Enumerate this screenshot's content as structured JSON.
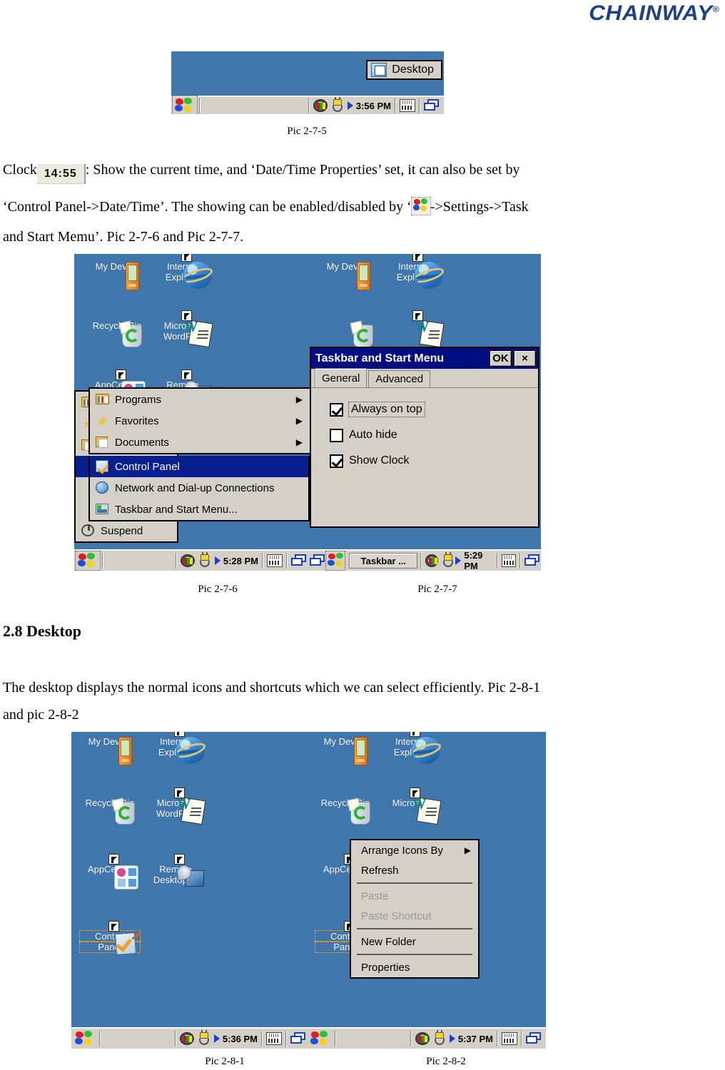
{
  "header": {
    "brand": "CHAINWAY",
    "registered": "®"
  },
  "pic275": {
    "caption": "Pic 2-7-5",
    "flyout_label": "Desktop",
    "flyout_icon": "desktop-icon",
    "tray_time": "3:56 PM"
  },
  "para1": {
    "before_clock": "Clock",
    "clock_value": "14:55",
    "after_clock": ": Show the current time, and ‘Date/Time Properties’ set, it can also be set by",
    "line2_a": "‘Control Panel->Date/Time’. The showing can be enabled/disabled by ‘",
    "line2_b": "->Settings->Task",
    "line3": "and Start Memu’. Pic 2-7-6 and Pic 2-7-7."
  },
  "desktop_icons": {
    "my_device": "My Device",
    "internet_explorer": "Internet\nExplorer",
    "internet_explorer_l1": "Internet",
    "internet_explorer_l2": "Explorer",
    "recycle_bin": "Recycle Bin",
    "wordpad_l1": "Microsoft",
    "wordpad_l2": "WordPad",
    "appcenter": "AppCenter",
    "remote_l1": "Remote",
    "remote_l2": "Desktop ...",
    "control_panel_l1": "Control",
    "control_panel_l2": "Panel"
  },
  "pic276": {
    "caption": "Pic 2-7-6",
    "tray_time": "5:28 PM",
    "start_menu_items": [
      {
        "label": "Programs",
        "icon": "programs-icon",
        "submenu": true,
        "state": "normal"
      },
      {
        "label": "Favorites",
        "icon": "favorites-icon",
        "submenu": true,
        "state": "normal"
      },
      {
        "label": "Documents",
        "icon": "documents-icon",
        "submenu": true,
        "state": "normal"
      }
    ],
    "settings_submenu": [
      {
        "label": "Control Panel",
        "icon": "control-panel-icon",
        "state": "highlighted"
      },
      {
        "label": "Network and Dial-up Connections",
        "icon": "network-icon",
        "state": "normal"
      },
      {
        "label": "Taskbar and Start Menu...",
        "icon": "taskbar-icon",
        "state": "normal"
      }
    ],
    "behind_items": [
      {
        "label": "Suspend",
        "icon": "suspend-icon"
      }
    ]
  },
  "pic277": {
    "caption": "Pic 2-7-7",
    "tray_time": "5:29 PM",
    "taskbar_button": "Taskbar ...",
    "dialog": {
      "title": "Taskbar and Start Menu",
      "ok": "OK",
      "close": "×",
      "tabs": [
        {
          "label": "General",
          "active": true
        },
        {
          "label": "Advanced",
          "active": false
        }
      ],
      "options": [
        {
          "label": "Always on top",
          "checked": true,
          "focused": true,
          "accel": "t"
        },
        {
          "label": "Auto hide",
          "checked": false,
          "focused": false,
          "accel": "u"
        },
        {
          "label": "Show Clock",
          "checked": true,
          "focused": false,
          "accel": "C"
        }
      ]
    }
  },
  "section28": {
    "heading": "2.8 Desktop",
    "body_line1": "The desktop displays the normal icons and shortcuts which we can select efficiently. Pic 2-8-1",
    "body_line2": "and pic 2-8-2"
  },
  "pic281": {
    "caption": "Pic 2-8-1",
    "tray_time": "5:36 PM"
  },
  "pic282": {
    "caption": "Pic 2-8-2",
    "tray_time": "5:37 PM",
    "context_menu": [
      {
        "label": "Arrange Icons By",
        "submenu": true,
        "state": "normal",
        "divider_after": false
      },
      {
        "label": "Refresh",
        "submenu": false,
        "state": "normal",
        "divider_after": true
      },
      {
        "label": "Paste",
        "submenu": false,
        "state": "disabled",
        "divider_after": false
      },
      {
        "label": "Paste Shortcut",
        "submenu": false,
        "state": "disabled",
        "divider_after": true
      },
      {
        "label": "New Folder",
        "submenu": false,
        "state": "normal",
        "divider_after": true
      },
      {
        "label": "Properties",
        "submenu": false,
        "state": "normal",
        "divider_after": false
      }
    ]
  },
  "colors": {
    "brand_blue": "#1f3f88",
    "desktop_blue": "#3f77ac",
    "taskbar_gray": "#d4d0c8",
    "title_navy": "#000e80",
    "menu_highlight": "#0a1f8f"
  }
}
